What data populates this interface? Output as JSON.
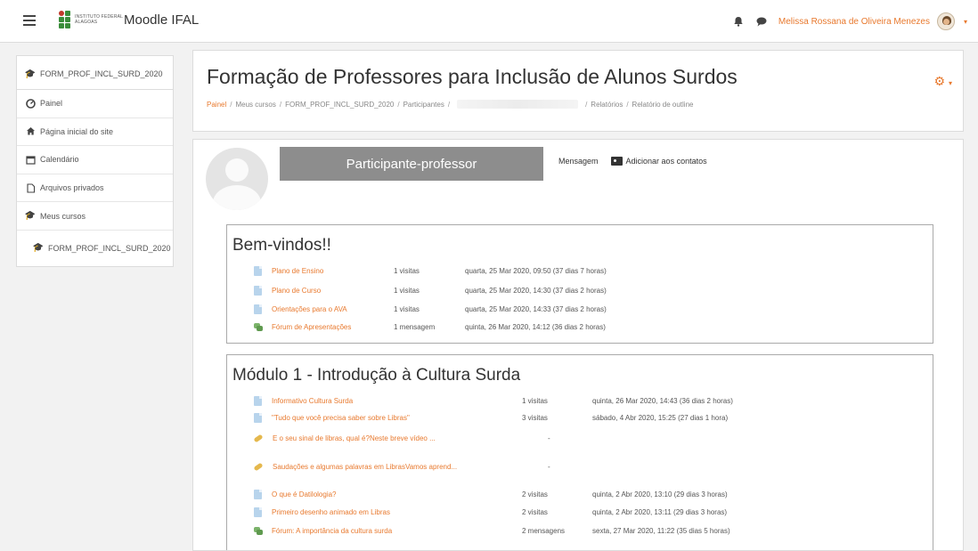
{
  "navbar": {
    "institution_text": "Instituto Federal Alagoas",
    "site_name": "Moodle IFAL",
    "user_name": "Melissa Rossana de Oliveira Menezes",
    "caret": "▾"
  },
  "sidebar": {
    "course_item": "FORM_PROF_INCL_SURD_2020",
    "items": [
      {
        "label": "Painel"
      },
      {
        "label": "Página inicial do site"
      },
      {
        "label": "Calendário"
      },
      {
        "label": "Arquivos privados"
      },
      {
        "label": "Meus cursos"
      },
      {
        "label": "FORM_PROF_INCL_SURD_2020"
      }
    ]
  },
  "header": {
    "title": "Formação de Professores para Inclusão de Alunos Surdos",
    "breadcrumb": [
      "Painel",
      "Meus cursos",
      "FORM_PROF_INCL_SURD_2020",
      "Participantes",
      "Relatórios",
      "Relatório de outline"
    ],
    "gear_caret": "▾"
  },
  "profile": {
    "name": "Participante-professor",
    "message_label": "Mensagem",
    "add_contact_label": "Adicionar aos contatos"
  },
  "sections": [
    {
      "title": "Bem-vindos!!",
      "rows": [
        {
          "icon": "file",
          "name": "Plano de Ensino",
          "count": "1 visitas",
          "date": "quarta, 25 Mar 2020, 09:50 (37 dias 7 horas)"
        },
        {
          "icon": "file",
          "name": "Plano de Curso",
          "count": "1 visitas",
          "date": "quarta, 25 Mar 2020, 14:30 (37 dias 2 horas)"
        },
        {
          "icon": "file",
          "name": "Orientações para o AVA",
          "count": "1 visitas",
          "date": "quarta, 25 Mar 2020, 14:33 (37 dias 2 horas)"
        },
        {
          "icon": "forum",
          "name": "Fórum de Apresentações",
          "count": "1 mensagem",
          "date": "quinta, 26 Mar 2020, 14:12 (36 dias 2 horas)"
        }
      ]
    },
    {
      "title": "Módulo 1 - Introdução à Cultura Surda",
      "rows": [
        {
          "icon": "file",
          "name": "Informativo Cultura Surda",
          "count": "1 visitas",
          "date": "quinta, 26 Mar 2020, 14:43 (36 dias 2 horas)"
        },
        {
          "icon": "file",
          "name": "\"Tudo que você precisa saber sobre Libras\"",
          "count": "3 visitas",
          "date": "sábado, 4 Abr 2020, 15:25 (27 dias 1 hora)"
        },
        {
          "icon": "url",
          "name": "E o seu sinal de libras, qual é?Neste breve vídeo ...",
          "count": "-",
          "date": ""
        },
        {
          "icon": "url",
          "name": "Saudações e algumas palavras em LibrasVamos aprend...",
          "count": "-",
          "date": ""
        },
        {
          "icon": "file",
          "name": "O que é Datilologia?",
          "count": "2 visitas",
          "date": "quinta, 2 Abr 2020, 13:10 (29 dias 3 horas)"
        },
        {
          "icon": "file",
          "name": "Primeiro desenho animado em Libras",
          "count": "2 visitas",
          "date": "quinta, 2 Abr 2020, 13:11 (29 dias 3 horas)"
        },
        {
          "icon": "forum",
          "name": "Fórum: A importância da cultura surda",
          "count": "2 mensagens",
          "date": "sexta, 27 Mar 2020, 11:22 (35 dias 5 horas)"
        }
      ]
    }
  ]
}
